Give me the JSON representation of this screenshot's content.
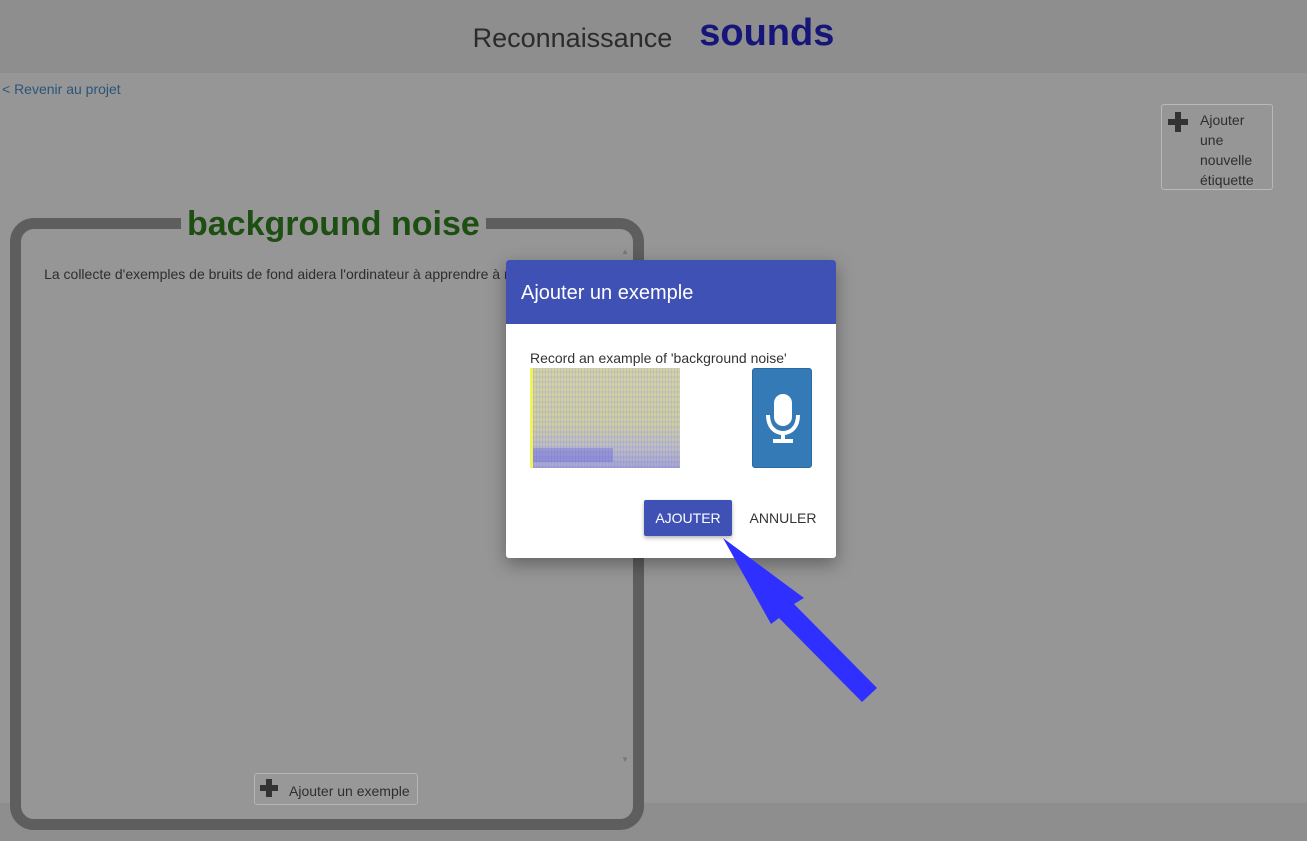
{
  "header": {
    "app_name": "Reconnaissance",
    "project_name": "sounds"
  },
  "nav": {
    "back_link": "< Revenir au projet"
  },
  "toolbar": {
    "add_label": "Ajouter une nouvelle étiquette"
  },
  "label_card": {
    "title": "background noise",
    "description": "La collecte d'exemples de bruits de fond aidera l'ordinateur à apprendre à reconnaître les sons.",
    "add_example": "Ajouter un exemple"
  },
  "dialog": {
    "title": "Ajouter un exemple",
    "prompt": "Record an example of 'background noise'",
    "add_button": "AJOUTER",
    "cancel_button": "ANNULER"
  },
  "icons": {
    "plus": "plus-icon",
    "microphone": "microphone-icon",
    "annotation_arrow": "arrow-icon"
  },
  "colors": {
    "dialog_header": "#3f51b5",
    "project_name": "#16167a",
    "label_title": "#1e4f12",
    "mic_button": "#337ab7",
    "annotation_arrow": "#2f2fff"
  }
}
